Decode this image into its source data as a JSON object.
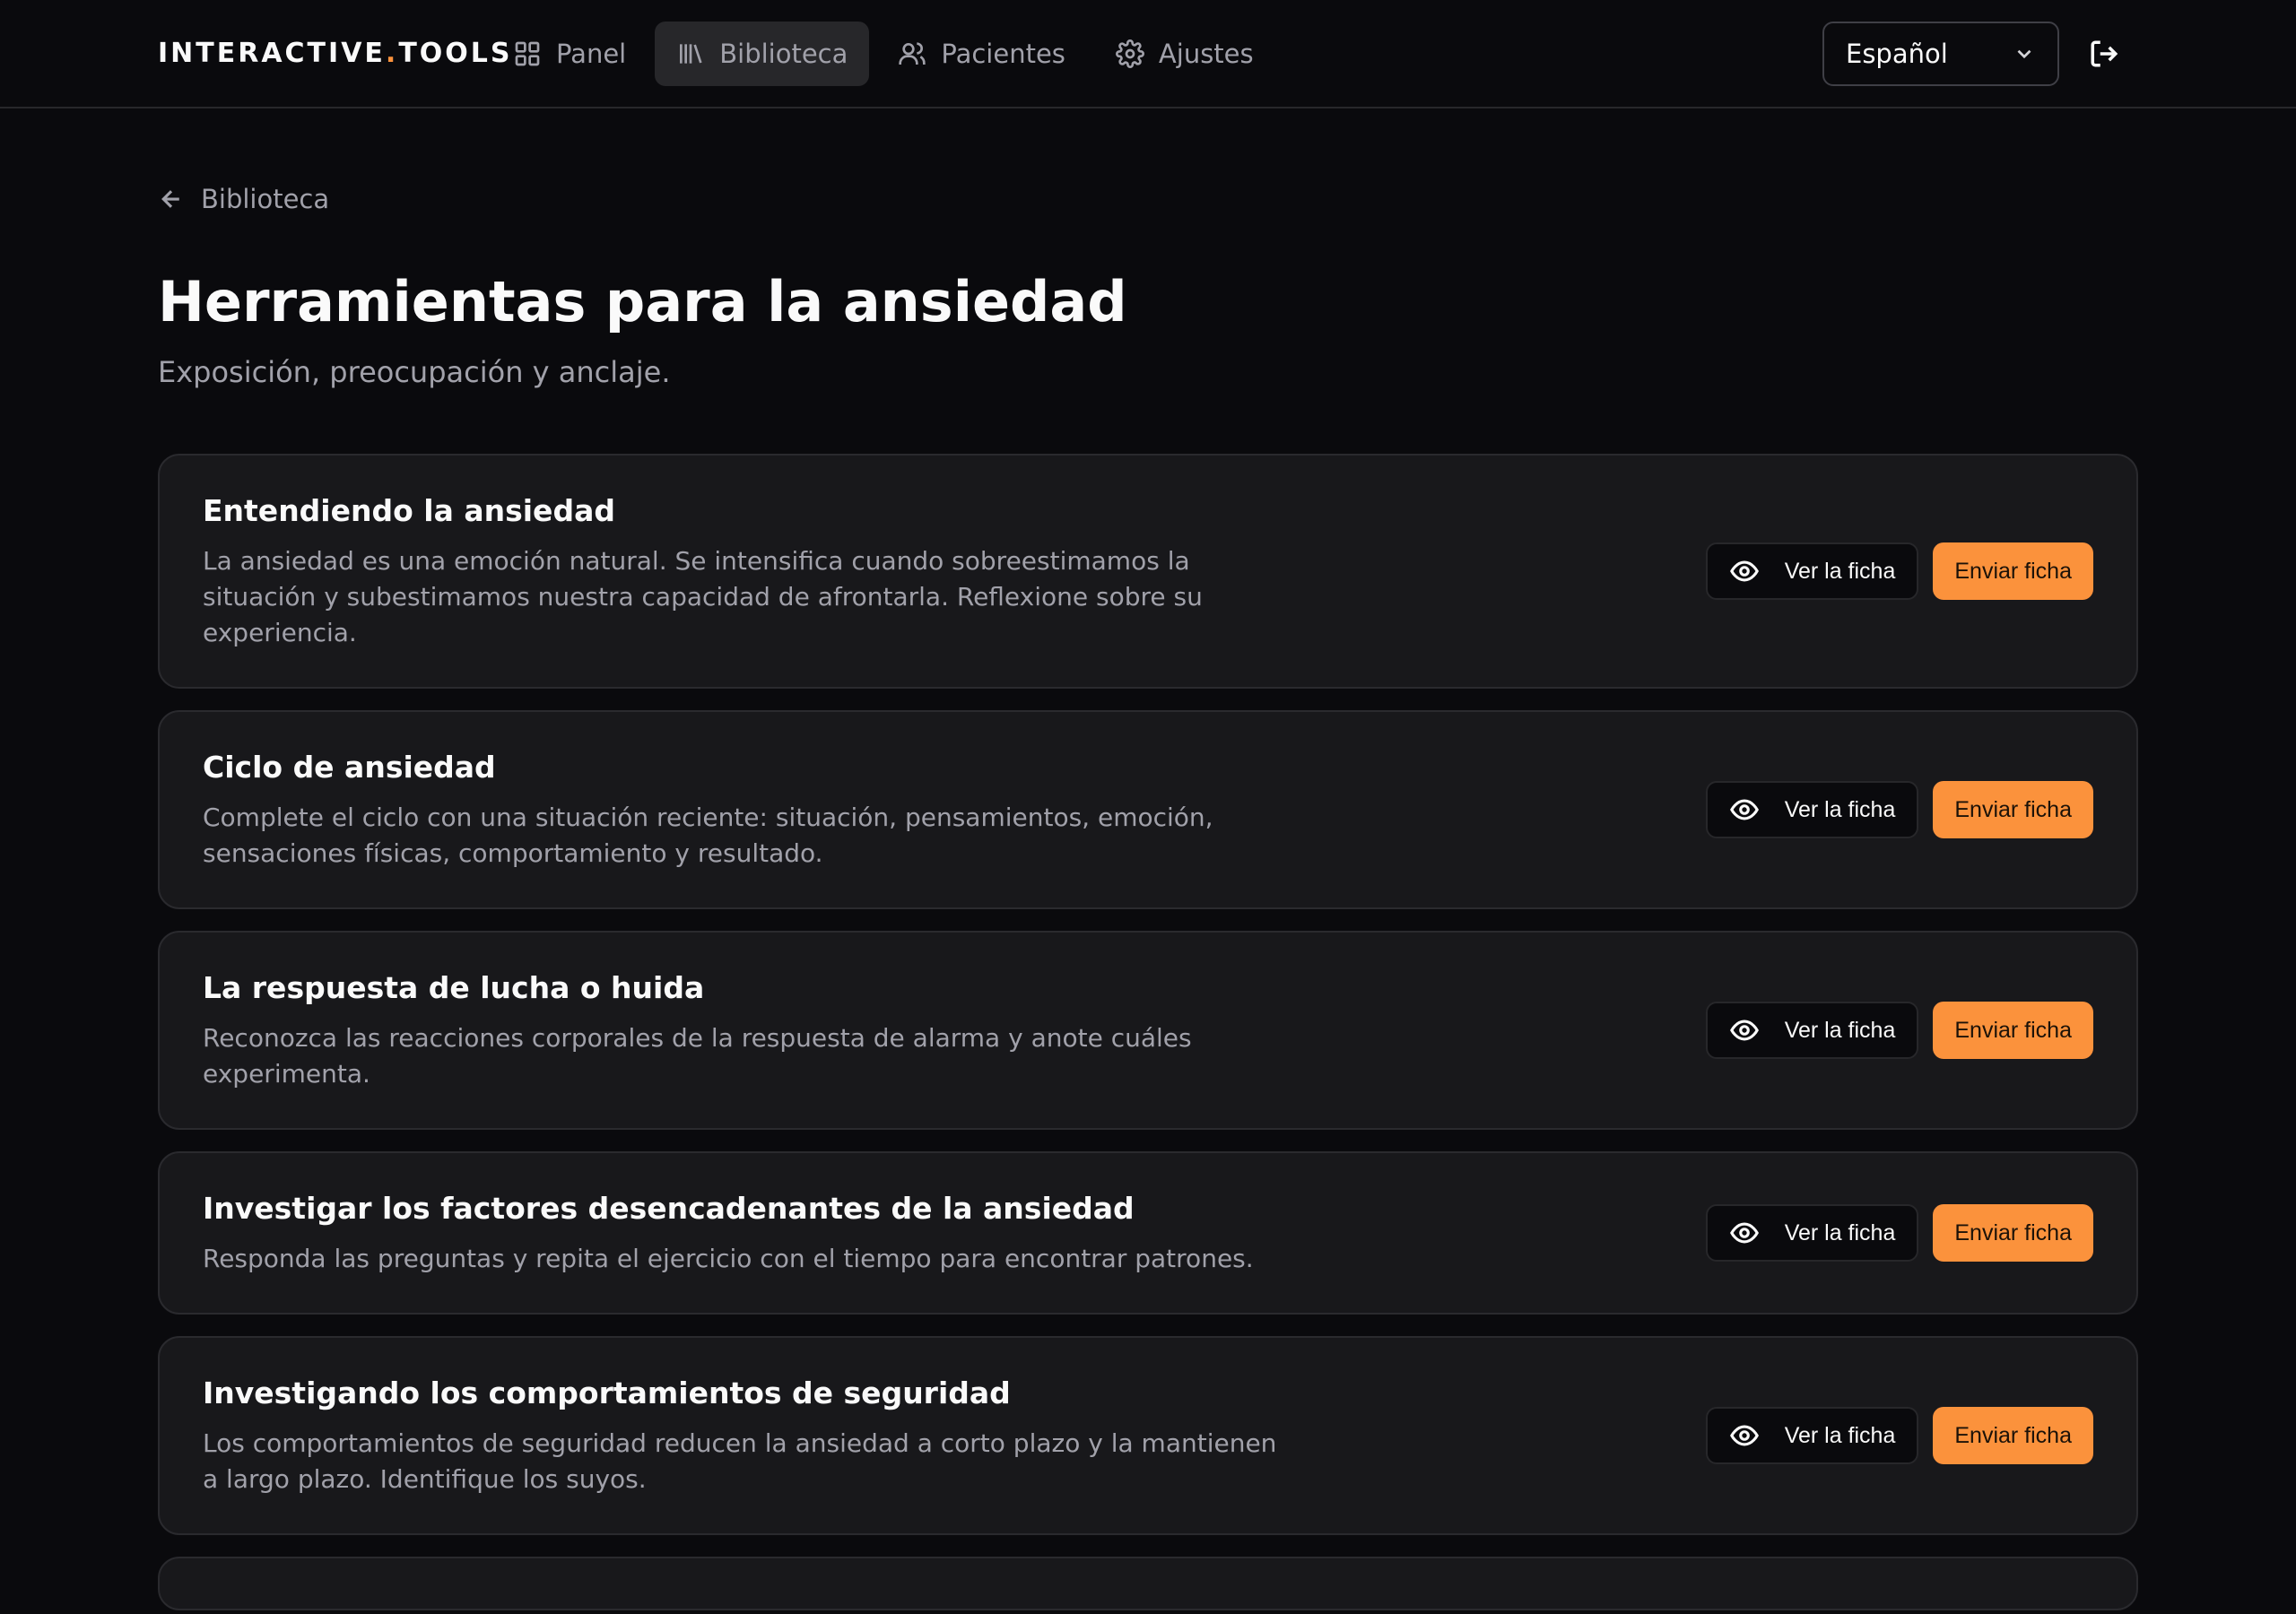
{
  "brand": {
    "prefix": "INTERACTIVE",
    "dot": ".",
    "suffix": "TOOLS"
  },
  "nav": {
    "items": [
      {
        "label": "Panel",
        "icon": "grid-icon"
      },
      {
        "label": "Biblioteca",
        "icon": "library-icon",
        "active": true
      },
      {
        "label": "Pacientes",
        "icon": "users-icon"
      },
      {
        "label": "Ajustes",
        "icon": "gear-icon"
      }
    ],
    "language": "Español"
  },
  "breadcrumb": {
    "back_label": "Biblioteca"
  },
  "page": {
    "title": "Herramientas para la ansiedad",
    "subtitle": "Exposición, preocupación y anclaje."
  },
  "actions": {
    "view_label": "Ver la ficha",
    "send_label": "Enviar ficha"
  },
  "colors": {
    "accent": "#fb923c",
    "background": "#0a0a0d",
    "card": "#18181b"
  },
  "tools": [
    {
      "title": "Entendiendo la ansiedad",
      "description": "La ansiedad es una emoción natural. Se intensifica cuando sobreestimamos la situación y subestimamos nuestra capacidad de afrontarla. Reflexione sobre su experiencia."
    },
    {
      "title": "Ciclo de ansiedad",
      "description": "Complete el ciclo con una situación reciente: situación, pensamientos, emoción, sensaciones físicas, comportamiento y resultado."
    },
    {
      "title": "La respuesta de lucha o huida",
      "description": "Reconozca las reacciones corporales de la respuesta de alarma y anote cuáles experimenta."
    },
    {
      "title": "Investigar los factores desencadenantes de la ansiedad",
      "description": "Responda las preguntas y repita el ejercicio con el tiempo para encontrar patrones."
    },
    {
      "title": "Investigando los comportamientos de seguridad",
      "description": "Los comportamientos de seguridad reducen la ansiedad a corto plazo y la mantienen a largo plazo. Identifique los suyos."
    }
  ]
}
